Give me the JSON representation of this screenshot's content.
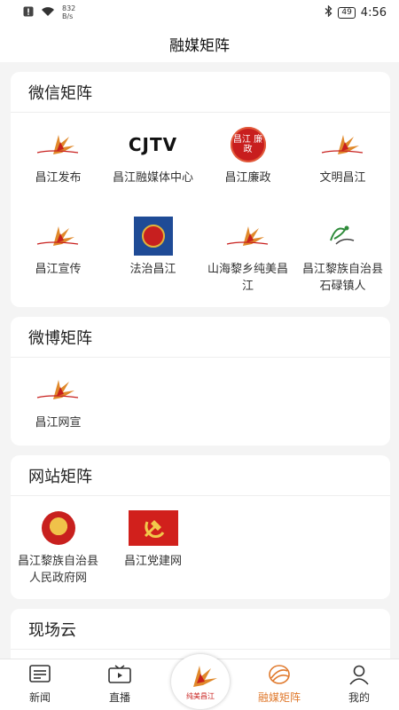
{
  "status_bar": {
    "net_speed_value": "832",
    "net_speed_unit": "B/s",
    "battery": "49",
    "time": "4:56"
  },
  "header": {
    "title": "融媒矩阵"
  },
  "sections": {
    "wechat": {
      "title": "微信矩阵",
      "items": [
        {
          "label": "昌江发布"
        },
        {
          "label": "昌江融媒体中心",
          "logo_text": "CJTV"
        },
        {
          "label": "昌江廉政",
          "logo_text": "昌江 廉政"
        },
        {
          "label": "文明昌江"
        },
        {
          "label": "昌江宣传"
        },
        {
          "label": "法治昌江"
        },
        {
          "label": "山海黎乡纯美昌江"
        },
        {
          "label": "昌江黎族自治县石碌镇人"
        }
      ]
    },
    "weibo": {
      "title": "微博矩阵",
      "items": [
        {
          "label": "昌江网宣"
        }
      ]
    },
    "website": {
      "title": "网站矩阵",
      "items": [
        {
          "label": "昌江黎族自治县人民政府网"
        },
        {
          "label": "昌江党建网"
        }
      ]
    },
    "live_cloud": {
      "title": "现场云"
    }
  },
  "tabbar": {
    "items": [
      {
        "label": "新闻",
        "icon": "news-icon"
      },
      {
        "label": "直播",
        "icon": "tv-icon"
      },
      {
        "label": "融媒矩阵",
        "icon": "matrix-icon",
        "active": true
      },
      {
        "label": "我的",
        "icon": "user-icon"
      }
    ],
    "center_logo_text": "纯美昌江"
  },
  "colors": {
    "accent": "#e07a2e",
    "brand_red": "#d1201c",
    "background": "#f4f4f4"
  }
}
